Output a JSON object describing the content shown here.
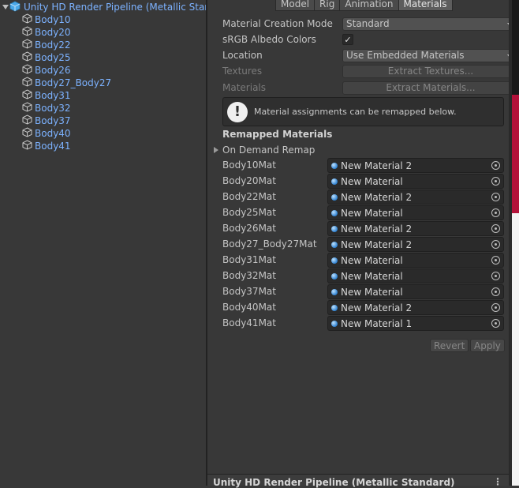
{
  "hierarchy": {
    "root_label": "Unity HD Render Pipeline (Metallic Standard)",
    "items": [
      {
        "label": "Body10"
      },
      {
        "label": "Body20"
      },
      {
        "label": "Body22"
      },
      {
        "label": "Body25"
      },
      {
        "label": "Body26"
      },
      {
        "label": "Body27_Body27"
      },
      {
        "label": "Body31"
      },
      {
        "label": "Body32"
      },
      {
        "label": "Body37"
      },
      {
        "label": "Body40"
      },
      {
        "label": "Body41"
      }
    ]
  },
  "inspector": {
    "tabs": [
      "Model",
      "Rig",
      "Animation",
      "Materials"
    ],
    "active_tab": "Materials",
    "material_creation_mode": {
      "label": "Material Creation Mode",
      "value": "Standard"
    },
    "srgb_albedo": {
      "label": "sRGB Albedo Colors",
      "checked": true,
      "check_glyph": "✓"
    },
    "location": {
      "label": "Location",
      "value": "Use Embedded Materials"
    },
    "textures": {
      "label": "Textures",
      "button": "Extract Textures..."
    },
    "materials": {
      "label": "Materials",
      "button": "Extract Materials..."
    },
    "help": {
      "icon": "!",
      "text": "Material assignments can be remapped below."
    },
    "remapped_title": "Remapped Materials",
    "on_demand_remap": "On Demand Remap",
    "remaps": [
      {
        "label": "Body10Mat",
        "value": "New Material 2"
      },
      {
        "label": "Body20Mat",
        "value": "New Material"
      },
      {
        "label": "Body22Mat",
        "value": "New Material 2"
      },
      {
        "label": "Body25Mat",
        "value": "New Material"
      },
      {
        "label": "Body26Mat",
        "value": "New Material 2"
      },
      {
        "label": "Body27_Body27Mat",
        "value": "New Material 2"
      },
      {
        "label": "Body31Mat",
        "value": "New Material"
      },
      {
        "label": "Body32Mat",
        "value": "New Material"
      },
      {
        "label": "Body37Mat",
        "value": "New Material"
      },
      {
        "label": "Body40Mat",
        "value": "New Material 2"
      },
      {
        "label": "Body41Mat",
        "value": "New Material 1"
      }
    ],
    "revert_label": "Revert",
    "apply_label": "Apply"
  },
  "bottom_bar": {
    "title": "Unity HD Render Pipeline (Metallic Standard)",
    "menu_glyph": "⋮"
  },
  "colors": {
    "accent_blue": "#7cb2ff",
    "panel": "#383838",
    "scene_red": "#b3123a"
  },
  "icons": {
    "prefab": "prefab-cube-icon",
    "mesh": "gameobject-cube-icon",
    "material": "material-sphere-icon",
    "picker": "object-picker-icon",
    "help": "info-icon"
  }
}
